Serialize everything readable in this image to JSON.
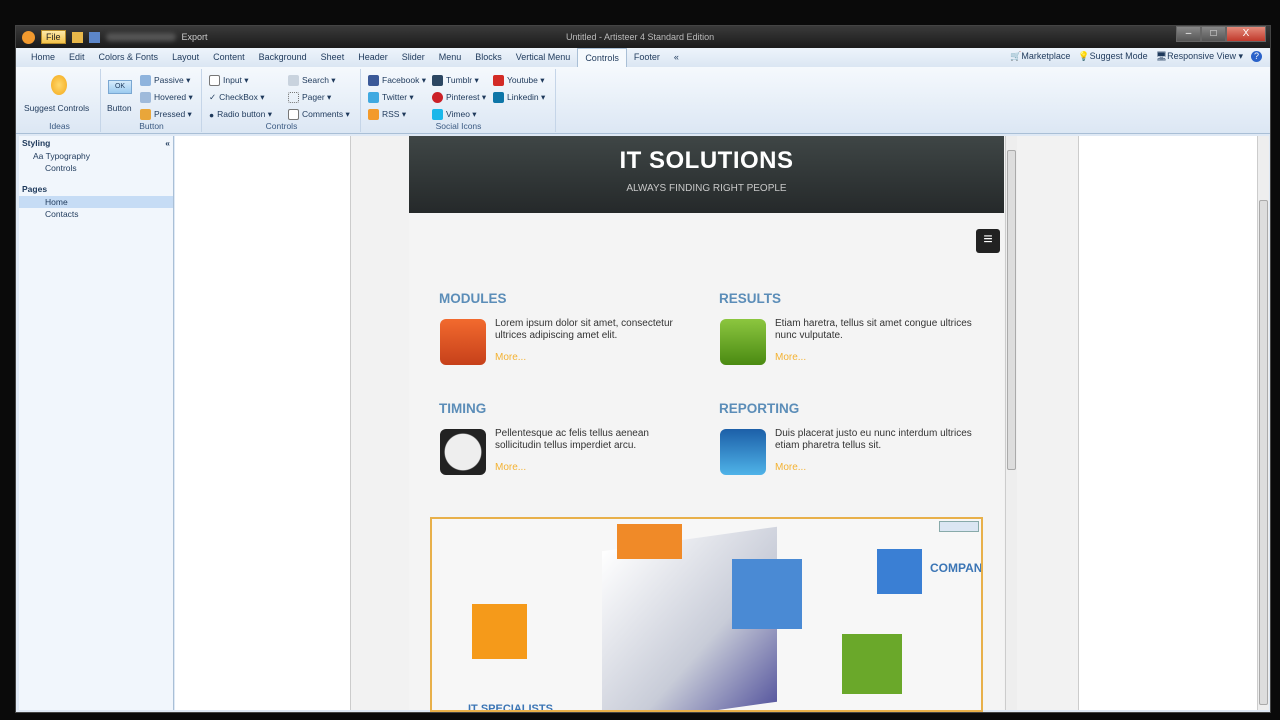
{
  "titlebar": {
    "file": "File",
    "export": "Export",
    "title": "Untitled - Artisteer 4 Standard Edition",
    "min": "–",
    "max": "□",
    "close": "X"
  },
  "tabs": [
    "Home",
    "Edit",
    "Colors & Fonts",
    "Layout",
    "Content",
    "Background",
    "Sheet",
    "Header",
    "Slider",
    "Menu",
    "Blocks",
    "Vertical Menu",
    "Controls",
    "Footer",
    "«"
  ],
  "tabs_right": {
    "marketplace": "Marketplace",
    "suggest": "Suggest Mode",
    "responsive": "Responsive View ▾",
    "help": "?"
  },
  "ribbon": {
    "ideas": {
      "label": "Ideas",
      "suggest": "Suggest Controls"
    },
    "button": {
      "label": "Button",
      "main": "Button",
      "ok": "OK",
      "passive": "Passive ▾",
      "hovered": "Hovered ▾",
      "pressed": "Pressed ▾"
    },
    "controls": {
      "label": "Controls",
      "input": "Input ▾",
      "checkbox": "CheckBox ▾",
      "radio": "Radio button ▾",
      "search": "Search ▾",
      "pager": "Pager ▾",
      "comments": "Comments ▾"
    },
    "social": {
      "label": "Social Icons",
      "facebook": "Facebook ▾",
      "twitter": "Twitter ▾",
      "rss": "RSS ▾",
      "tumblr": "Tumblr ▾",
      "pinterest": "Pinterest ▾",
      "vimeo": "Vimeo ▾",
      "youtube": "Youtube ▾",
      "linkedin": "Linkedin ▾"
    }
  },
  "left": {
    "styling": "Styling",
    "collapse": "«",
    "typography": "Aa Typography",
    "controls": "Controls",
    "pages": "Pages",
    "home": "Home",
    "contacts": "Contacts"
  },
  "page": {
    "title": "IT SOLUTIONS",
    "subtitle": "ALWAYS FINDING RIGHT PEOPLE",
    "menu": "≡",
    "features": [
      {
        "title": "MODULES",
        "text": "Lorem ipsum dolor sit amet, consectetur ultrices adipiscing amet elit.",
        "more": "More..."
      },
      {
        "title": "RESULTS",
        "text": "Etiam haretra, tellus sit amet congue ultrices nunc vulputate.",
        "more": "More..."
      },
      {
        "title": "TIMING",
        "text": "Pellentesque ac felis tellus aenean sollicitudin tellus imperdiet arcu.",
        "more": "More..."
      },
      {
        "title": "REPORTING",
        "text": "Duis placerat justo eu nunc interdum ultrices etiam pharetra tellus sit.",
        "more": "More..."
      }
    ],
    "slider": {
      "company": "COMPAN",
      "specialists": "IT SPECIALISTS"
    }
  }
}
